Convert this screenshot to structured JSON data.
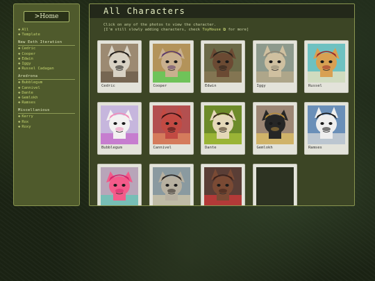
{
  "sidebar": {
    "home_label": ">Home",
    "top": [
      "All",
      "Template"
    ],
    "groups": [
      {
        "heading": "New Eeth Iteration",
        "items": [
          "Cedric",
          "Cooper",
          "Edwin",
          "Iggy",
          "Russel Cadagan"
        ]
      },
      {
        "heading": "Aredrona",
        "items": [
          "Bubblegum",
          "Cannivel",
          "Dante",
          "Gemlokh",
          "Ramses"
        ]
      },
      {
        "heading": "Miscellanious",
        "items": [
          "Kerry",
          "Rox",
          "Roxy"
        ]
      }
    ]
  },
  "main": {
    "title": "All Characters",
    "intro_line1": "Click on any of the photos to view the character.",
    "intro_line2_pre": "[I'm still slowly adding characters, check ",
    "intro_link": "ToyHouse",
    "intro_line2_post": " for more]"
  },
  "characters": [
    {
      "name": "Cedric",
      "bg": "#9c8a72",
      "face": "#d8d2c4",
      "hair": "#1c1a18",
      "accent": "#6a5a48"
    },
    {
      "name": "Cooper",
      "bg": "#b3935a",
      "face": "#c9b08e",
      "hair": "#5b3a6c",
      "accent": "#58d35a"
    },
    {
      "name": "Edwin",
      "bg": "#6b6a48",
      "face": "#6b4a33",
      "hair": "#2a221c",
      "accent": "#8b7a55"
    },
    {
      "name": "Iggy",
      "bg": "#8d9a8d",
      "face": "#cfc0a0",
      "hair": "#8e8673",
      "accent": "#b9a98a"
    },
    {
      "name": "Russel",
      "bg": "#6ec1c1",
      "face": "#d8a052",
      "hair": "#9b2b2b",
      "accent": "#f1e3bd"
    },
    {
      "name": "Bubblegum",
      "bg": "#c6b6dd",
      "face": "#f3f1f1",
      "hair": "#f18bb9",
      "accent": "#c56ac9"
    },
    {
      "name": "Cannivel",
      "bg": "#b35050",
      "face": "#c24a43",
      "hair": "#3a1212",
      "accent": "#e08a60"
    },
    {
      "name": "Dante",
      "bg": "#6d8b2a",
      "face": "#e4d8b8",
      "hair": "#3c2c1a",
      "accent": "#a9c23b"
    },
    {
      "name": "Gemlokh",
      "bg": "#9c8674",
      "face": "#262626",
      "hair": "#b48b3c",
      "accent": "#e2c266"
    },
    {
      "name": "Ramses",
      "bg": "#6a8fb8",
      "face": "#eeeeee",
      "hair": "#161616",
      "accent": "#d8d8d8"
    },
    {
      "name": "",
      "bg": "#b8a5b9",
      "face": "#f35b8a",
      "hair": "#d4246c",
      "accent": "#62c7b6"
    },
    {
      "name": "",
      "bg": "#8a9aa0",
      "face": "#b7b0a0",
      "hair": "#2b2520",
      "accent": "#d0c6a8"
    },
    {
      "name": "",
      "bg": "#5a3e36",
      "face": "#7a4a34",
      "hair": "#3a2019",
      "accent": "#d13a3a"
    },
    {
      "name": "",
      "bg": "#2d3322",
      "face": "",
      "hair": "",
      "accent": ""
    }
  ],
  "colors": {
    "panel": "#4f5a2c",
    "panel_border": "#8a9650",
    "title_bar": "#23281a",
    "link": "#c2d26e",
    "card": "#e3e3da"
  }
}
